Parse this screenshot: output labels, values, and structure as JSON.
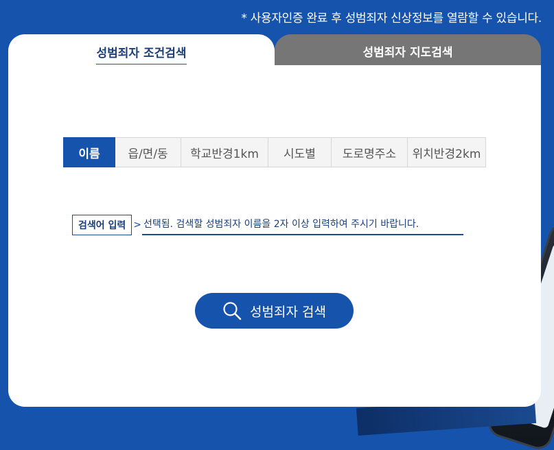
{
  "notice": "* 사용자인증 완료 후 성범죄자 신상정보를 열람할 수 있습니다.",
  "tabs": {
    "conditional": "성범죄자 조건검색",
    "map": "성범죄자 지도검색"
  },
  "filters": [
    {
      "label": "이름",
      "active": true
    },
    {
      "label": "읍/면/동",
      "active": false
    },
    {
      "label": "학교반경1km",
      "active": false
    },
    {
      "label": "시도별",
      "active": false
    },
    {
      "label": "도로명주소",
      "active": false
    },
    {
      "label": "위치반경2km",
      "active": false
    }
  ],
  "search": {
    "label": "검색어 입력",
    "placeholder": "선택됨. 검색할 성범죄자 이름을 2자 이상 입력하여 주시기 바랍니다."
  },
  "search_button": {
    "label": "성범죄자 검색",
    "icon": "search-icon"
  },
  "colors": {
    "background": "#1553ad",
    "accent": "#1553ad",
    "inactive_tab": "#767676"
  }
}
